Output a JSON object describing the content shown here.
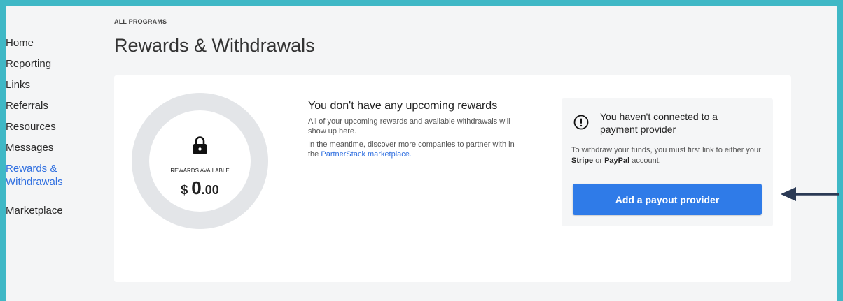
{
  "sidebar": {
    "items": [
      {
        "label": "Home"
      },
      {
        "label": "Reporting"
      },
      {
        "label": "Links"
      },
      {
        "label": "Referrals"
      },
      {
        "label": "Resources"
      },
      {
        "label": "Messages"
      },
      {
        "label": "Rewards & Withdrawals",
        "active": true
      },
      {
        "label": "Marketplace"
      }
    ]
  },
  "header": {
    "eyebrow": "ALL PROGRAMS",
    "title": "Rewards & Withdrawals"
  },
  "balance": {
    "label": "REWARDS AVAILABLE",
    "currency": "$ ",
    "amount_whole": "0",
    "amount_cents": ".00",
    "icon": "lock-icon"
  },
  "info": {
    "heading": "You don't have any upcoming rewards",
    "line1": "All of your upcoming rewards and available withdrawals will show up here.",
    "line2_pre": "In the meantime, discover more companies to partner with in the ",
    "marketplace_link": "PartnerStack marketplace.",
    "marketplace_link_color": "#2f6fe0"
  },
  "provider": {
    "icon": "alert-circle-icon",
    "title": "You haven't connected to a payment provider",
    "desc_pre": "To withdraw your funds, you must first link to either your ",
    "stripe": "Stripe",
    "or": " or ",
    "paypal": "PayPal",
    "desc_post": " account.",
    "button_label": "Add a payout provider",
    "button_color": "#2f7be8"
  },
  "annotation": {
    "arrow_icon": "arrow-left-icon",
    "arrow_color": "#2b3a55"
  },
  "colors": {
    "frame_border": "#3fb8c6",
    "page_bg": "#f4f5f6",
    "accent": "#2f6fe0"
  }
}
